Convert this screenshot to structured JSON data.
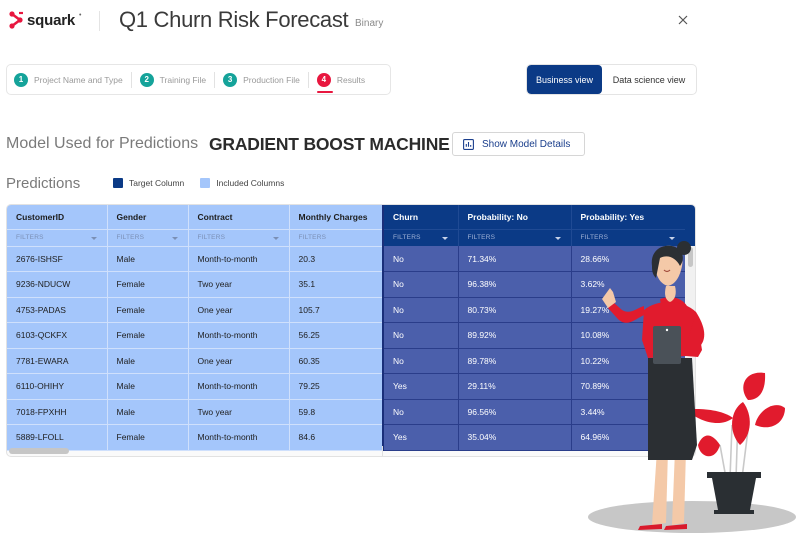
{
  "header": {
    "logo_text": "squark",
    "logo_tm": "•",
    "title": "Q1 Churn Risk Forecast",
    "subtitle": "Binary",
    "close_icon": "close-icon"
  },
  "stepper": {
    "steps": [
      {
        "number": "1",
        "label": "Project Name and Type",
        "state": "done"
      },
      {
        "number": "2",
        "label": "Training File",
        "state": "done"
      },
      {
        "number": "3",
        "label": "Production File",
        "state": "done"
      },
      {
        "number": "4",
        "label": "Results",
        "state": "active"
      }
    ]
  },
  "view_toggle": {
    "business": "Business view",
    "data_science": "Data science view",
    "selected": "Business view"
  },
  "model": {
    "label": "Model Used for Predictions",
    "name": "GRADIENT BOOST MACHINE",
    "details_button": "Show Model Details",
    "details_icon": "bar-chart-icon"
  },
  "predictions": {
    "label": "Predictions",
    "legend": [
      {
        "label": "Target Column",
        "color": "#0b3a86"
      },
      {
        "label": "Included Columns",
        "color": "#a4c6fb"
      }
    ]
  },
  "table": {
    "filter_placeholder": "FILTERS",
    "columns": [
      {
        "key": "customer_id",
        "label": "CustomerID",
        "type": "included",
        "filter_dropdown": true
      },
      {
        "key": "gender",
        "label": "Gender",
        "type": "included",
        "filter_dropdown": true
      },
      {
        "key": "contract",
        "label": "Contract",
        "type": "included",
        "filter_dropdown": true
      },
      {
        "key": "monthly_charges",
        "label": "Monthly Charges",
        "type": "included",
        "filter_dropdown": false
      },
      {
        "key": "churn",
        "label": "Churn",
        "type": "target",
        "filter_dropdown": true
      },
      {
        "key": "prob_no",
        "label": "Probability: No",
        "type": "target",
        "filter_dropdown": true
      },
      {
        "key": "prob_yes",
        "label": "Probability: Yes",
        "type": "target",
        "filter_dropdown": true
      }
    ],
    "rows": [
      [
        "2676-ISHSF",
        "Male",
        "Month-to-month",
        "20.3",
        "No",
        "71.34%",
        "28.66%"
      ],
      [
        "9236-NDUCW",
        "Female",
        "Two year",
        "35.1",
        "No",
        "96.38%",
        "3.62%"
      ],
      [
        "4753-PADAS",
        "Female",
        "One year",
        "105.7",
        "No",
        "80.73%",
        "19.27%"
      ],
      [
        "6103-QCKFX",
        "Female",
        "Month-to-month",
        "56.25",
        "No",
        "89.92%",
        "10.08%"
      ],
      [
        "7781-EWARA",
        "Male",
        "One year",
        "60.35",
        "No",
        "89.78%",
        "10.22%"
      ],
      [
        "6110-OHIHY",
        "Male",
        "Month-to-month",
        "79.25",
        "Yes",
        "29.11%",
        "70.89%"
      ],
      [
        "7018-FPXHH",
        "Male",
        "Two year",
        "59.8",
        "No",
        "96.56%",
        "3.44%"
      ],
      [
        "5889-LFOLL",
        "Female",
        "Month-to-month",
        "84.6",
        "Yes",
        "35.04%",
        "64.96%"
      ]
    ]
  },
  "colors": {
    "brand_red": "#e8173f",
    "step_teal": "#15a39a",
    "target_header": "#0b3a86",
    "target_cell": "#4b5fab",
    "included_cell": "#a4c6fb"
  },
  "illustration": {
    "description": "woman-holding-tablet-with-potted-plant"
  }
}
